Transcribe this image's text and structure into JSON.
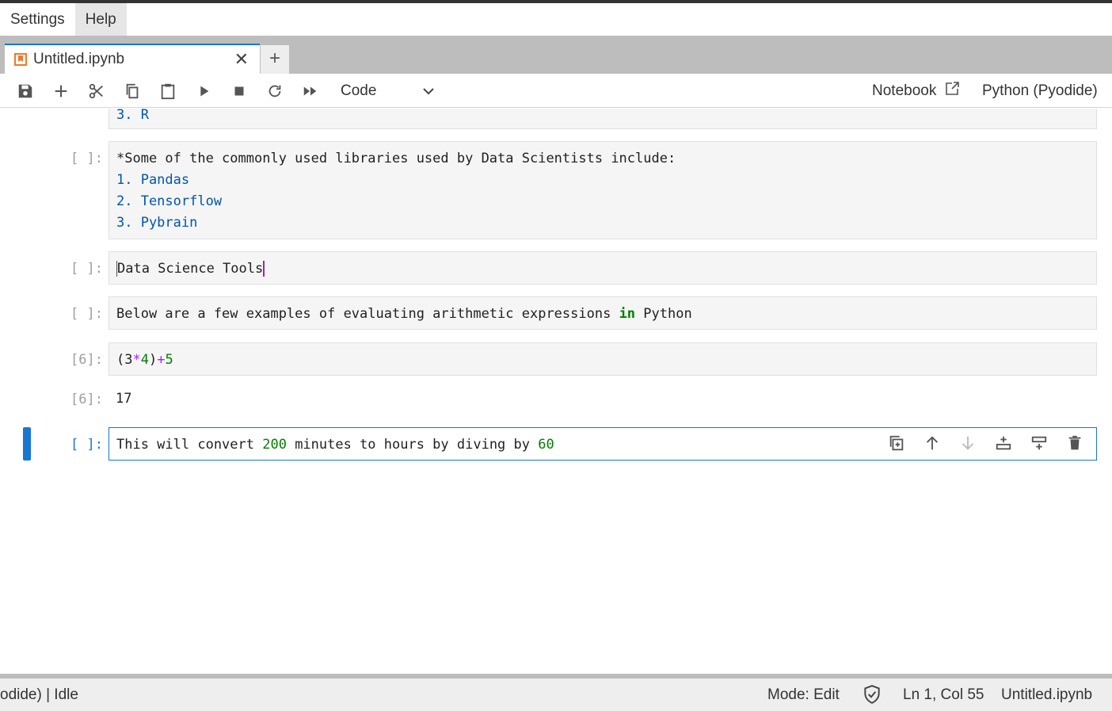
{
  "menu": {
    "items": [
      "Settings",
      "Help"
    ]
  },
  "tab": {
    "title": "Untitled.ipynb",
    "close": "✕",
    "add": "+"
  },
  "toolbar": {
    "cell_type": "Code",
    "notebook_label": "Notebook",
    "kernel_label": "Python (Pyodide)"
  },
  "cells": {
    "c0": {
      "line": "3. R"
    },
    "c1": {
      "prompt": "[ ]:",
      "line1": "*Some of the commonly used libraries used by Data Scientists include:",
      "l2": "1. Pandas",
      "l3": "2. Tensorflow",
      "l4": "3. Pybrain"
    },
    "c2": {
      "prompt": "[ ]:",
      "text": "Data Science Tools"
    },
    "c3": {
      "prompt": "[ ]:",
      "pre": "Below are a few examples of evaluating arithmetic expressions ",
      "kw": "in",
      "post": " Python"
    },
    "c4": {
      "prompt": "[6]:",
      "a": "(3",
      "b": "*",
      "c": "4",
      "d": ")",
      "e": "+",
      "f": "5"
    },
    "o4": {
      "prompt": "[6]:",
      "value": "17"
    },
    "c5": {
      "prompt": "[ ]:",
      "a": "This will convert ",
      "n1": "200",
      "b": " minutes to hours by diving by ",
      "n2": "60"
    }
  },
  "status": {
    "kernel": "odide) | Idle",
    "mode": "Mode: Edit",
    "position": "Ln 1, Col 55",
    "file": "Untitled.ipynb"
  },
  "colors": {
    "accent": "#1976d2",
    "number": "#008000",
    "list": "#0055aa",
    "cursor": "#9c27b0"
  },
  "icons": [
    "notebook-icon",
    "save-icon",
    "add-icon",
    "cut-icon",
    "copy-icon",
    "paste-icon",
    "run-icon",
    "stop-icon",
    "restart-icon",
    "fast-forward-icon",
    "chevron-down-icon",
    "external-link-icon",
    "shield-check-icon",
    "duplicate-icon",
    "arrow-up-icon",
    "arrow-down-icon",
    "insert-below-icon",
    "insert-above-icon",
    "trash-icon"
  ]
}
